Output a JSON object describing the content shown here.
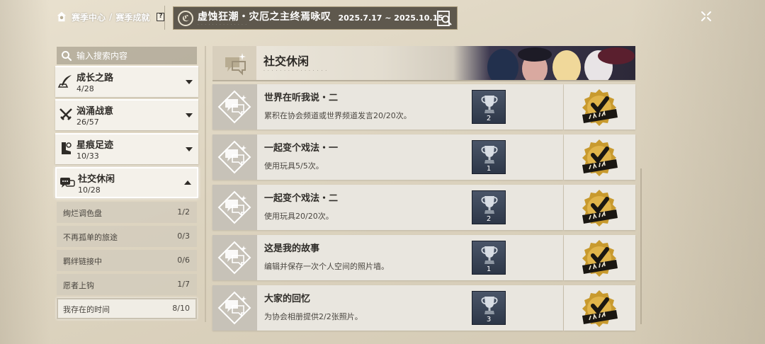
{
  "breadcrumb": {
    "season_center": "赛季中心",
    "separator": "/",
    "season_achievements": "赛季成就"
  },
  "season": {
    "title": "虚蚀狂潮・灾厄之主终焉咏叹",
    "dates": "2025.7.17 ~ 2025.10.15"
  },
  "search": {
    "placeholder": "输入搜索内容"
  },
  "categories": [
    {
      "name": "成长之路",
      "count": "4/28",
      "icon": "quill-icon"
    },
    {
      "name": "汹涌战意",
      "count": "26/57",
      "icon": "crossed-swords-icon"
    },
    {
      "name": "星痕足迹",
      "count": "10/33",
      "icon": "boot-icon"
    },
    {
      "name": "社交休闲",
      "count": "10/28",
      "icon": "chat-bubble-icon"
    }
  ],
  "subcategories": [
    {
      "name": "绚烂调色盘",
      "count": "1/2"
    },
    {
      "name": "不再孤单的旅途",
      "count": "0/3"
    },
    {
      "name": "羁绊链接中",
      "count": "0/6"
    },
    {
      "name": "愿者上钩",
      "count": "1/7"
    },
    {
      "name": "我存在的时间",
      "count": "8/10"
    }
  ],
  "header": {
    "title": "社交休闲"
  },
  "achievements": [
    {
      "title": "世界在听我说・二",
      "desc": "累积在协会频道或世界频道发言20/20次。",
      "tier": "2"
    },
    {
      "title": "一起变个戏法・一",
      "desc": "使用玩具5/5次。",
      "tier": "1"
    },
    {
      "title": "一起变个戏法・二",
      "desc": "使用玩具20/20次。",
      "tier": "2"
    },
    {
      "title": "这是我的故事",
      "desc": "编辑并保存一次个人空间的照片墙。",
      "tier": "1"
    },
    {
      "title": "大家的回忆",
      "desc": "为协会相册提供2/2张照片。",
      "tier": "3"
    }
  ],
  "colors": {
    "trophy_bg": "#2d3748",
    "badge_gold": "#c89a2e",
    "banner_bg": "#5e584d"
  }
}
